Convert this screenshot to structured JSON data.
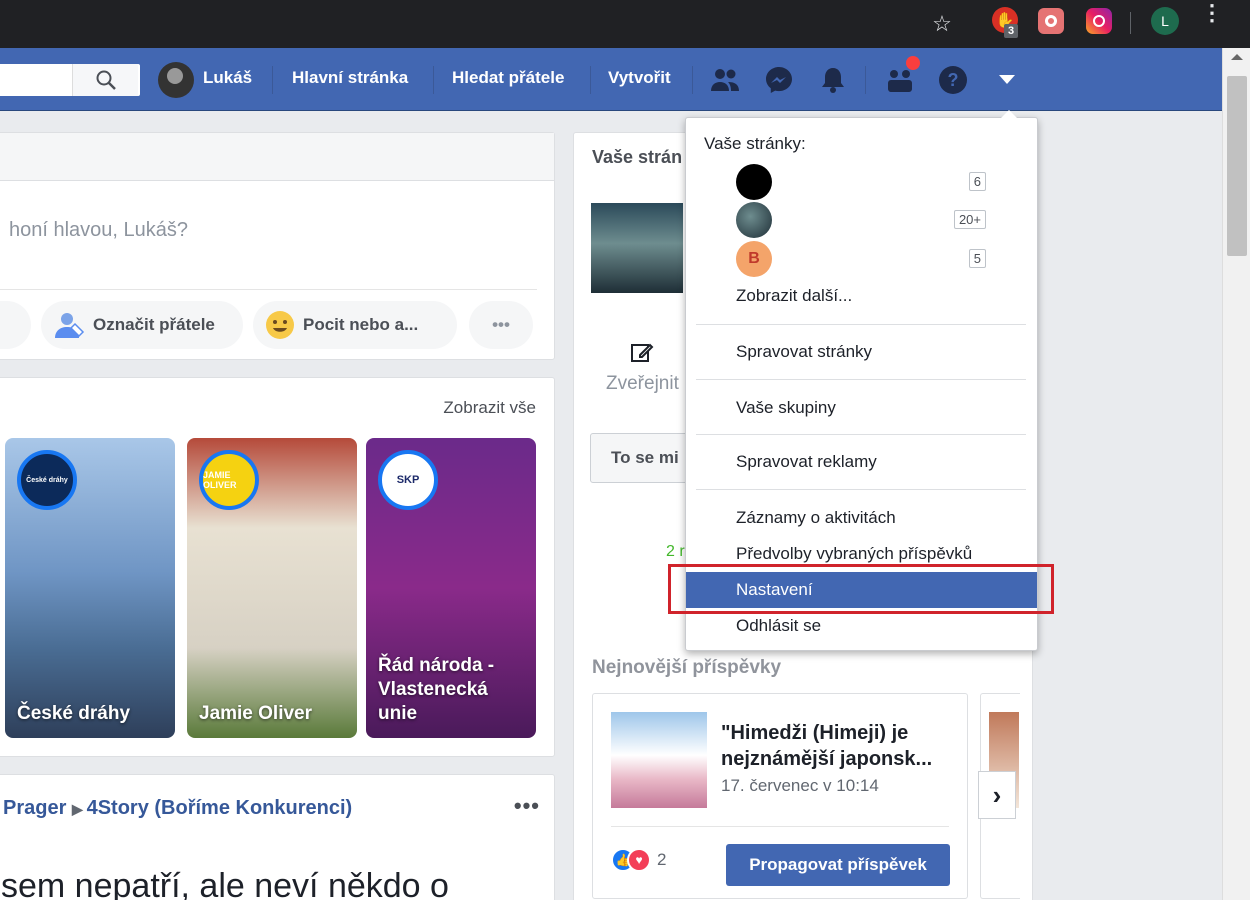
{
  "chrome": {
    "extension_badge": "3",
    "profile_initial": "L"
  },
  "nav": {
    "user_name": "Lukáš",
    "home": "Hlavní stránka",
    "find_friends": "Hledat přátele",
    "create": "Vytvořit",
    "brand_color": "#4267b2"
  },
  "composer": {
    "prompt": "honí hlavou, Lukáš?",
    "pill_left": ".",
    "tag_friends": "Označit přátele",
    "feeling": "Pocit nebo a...",
    "more": "•••"
  },
  "stories": {
    "show_all": "Zobrazit vše",
    "items": [
      {
        "name": "České dráhy",
        "logo": "České dráhy"
      },
      {
        "name": "Jamie Oliver",
        "logo": "JAMIE OLIVER"
      },
      {
        "name": "Řád národa - Vlastenecká unie",
        "logo": "SKP"
      }
    ]
  },
  "post": {
    "author1": "Prager",
    "author2": "4Story (Boříme Konkurenci)",
    "text": "sem nepatří, ale neví někdo o"
  },
  "pages": {
    "title": "Vaše strán",
    "publish": "Zveřejnit",
    "tose": "To se mi",
    "green_text": "2 r",
    "latest_title": "Nejnovější příspěvky",
    "latest_post_title": "\"Himedži (Himeji) je nejznámější japonsk...",
    "latest_post_date": "17. červenec v 10:14",
    "reactions": "2",
    "promote": "Propagovat příspěvek"
  },
  "dropdown": {
    "heading": "Vaše stránky:",
    "pages": [
      {
        "count": "6",
        "initial": ""
      },
      {
        "count": "20+",
        "initial": ""
      },
      {
        "count": "5",
        "initial": "B"
      }
    ],
    "show_more": "Zobrazit další...",
    "manage_pages": "Spravovat stránky",
    "your_groups": "Vaše skupiny",
    "manage_ads": "Spravovat reklamy",
    "activity_log": "Záznamy o aktivitách",
    "news_feed_prefs": "Předvolby vybraných příspěvků",
    "settings": "Nastavení",
    "logout": "Odhlásit se",
    "highlight_color": "#4267b2",
    "callout_color": "#d0232b"
  }
}
